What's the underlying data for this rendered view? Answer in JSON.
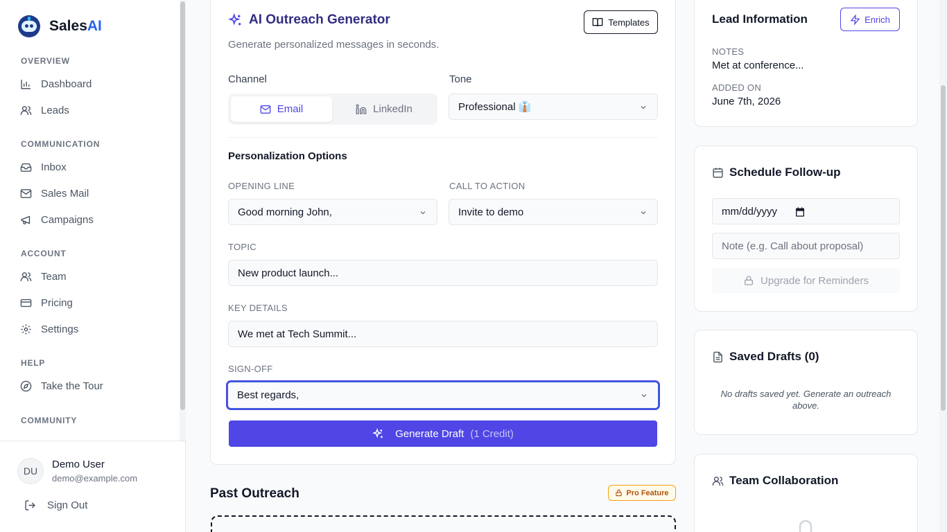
{
  "brand": {
    "name_prefix": "Sales",
    "name_suffix": "AI"
  },
  "sidebar": {
    "sections": {
      "overview": "OVERVIEW",
      "communication": "COMMUNICATION",
      "account": "ACCOUNT",
      "help": "HELP",
      "community": "COMMUNITY"
    },
    "items": {
      "dashboard": "Dashboard",
      "leads": "Leads",
      "inbox": "Inbox",
      "sales_mail": "Sales Mail",
      "campaigns": "Campaigns",
      "team": "Team",
      "pricing": "Pricing",
      "settings": "Settings",
      "tour": "Take the Tour"
    },
    "user": {
      "initials": "DU",
      "name": "Demo User",
      "email": "demo@example.com"
    },
    "sign_out": "Sign Out"
  },
  "generator": {
    "title": "AI Outreach Generator",
    "subtitle": "Generate personalized messages in seconds.",
    "templates_label": "Templates",
    "channel_label": "Channel",
    "channel_email": "Email",
    "channel_linkedin": "LinkedIn",
    "tone_label": "Tone",
    "tone_value": "Professional 👔",
    "personalization_title": "Personalization Options",
    "opening_label": "OPENING LINE",
    "opening_value": "Good morning John,",
    "cta_label": "CALL TO ACTION",
    "cta_value": "Invite to demo",
    "topic_label": "TOPIC",
    "topic_value": "New product launch...",
    "details_label": "KEY DETAILS",
    "details_value": "We met at Tech Summit...",
    "signoff_label": "SIGN-OFF",
    "signoff_value": "Best regards,",
    "generate_label": "Generate Draft",
    "generate_credit": "(1 Credit)"
  },
  "past_outreach": {
    "title": "Past Outreach",
    "badge": "Pro Feature"
  },
  "lead_info": {
    "title": "Lead Information",
    "enrich_label": "Enrich",
    "notes_label": "NOTES",
    "notes_value": "Met at conference...",
    "added_label": "ADDED ON",
    "added_value": "June 7th, 2026"
  },
  "follow_up": {
    "title": "Schedule Follow-up",
    "date_value": "mm/dd/yyyy",
    "note_placeholder": "Note (e.g. Call about proposal)",
    "upgrade_label": "Upgrade for Reminders"
  },
  "saved_drafts": {
    "title": "Saved Drafts (0)",
    "empty": "No drafts saved yet. Generate an outreach above."
  },
  "team_collab": {
    "title": "Team Collaboration"
  },
  "colors": {
    "accent": "#4f46e5",
    "brand_blue": "#2563eb",
    "pro_amber": "#f59e0b"
  }
}
